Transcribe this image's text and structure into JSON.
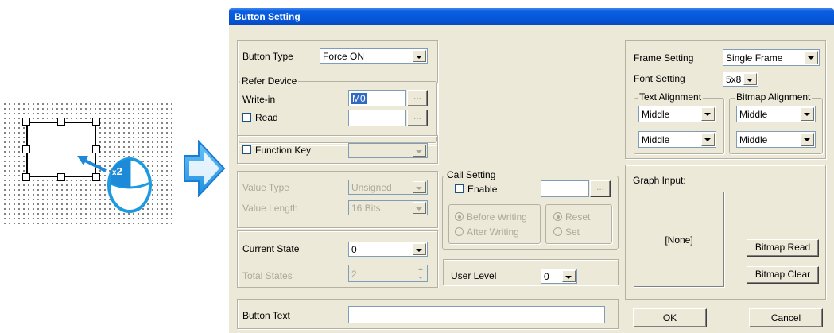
{
  "illustration": {
    "mouse_badge": "x2",
    "mouse_number": "2"
  },
  "dialog": {
    "title": "Button Setting",
    "button_type": {
      "label": "Button Type",
      "value": "Force ON"
    },
    "refer_device": {
      "legend": "Refer Device",
      "write_in_label": "Write-in",
      "write_in_value": "M0",
      "read_label": "Read",
      "browse_label": "..."
    },
    "function_key": {
      "label": "Function Key"
    },
    "value_type": {
      "label": "Value Type",
      "value": "Unsigned"
    },
    "value_length": {
      "label": "Value Length",
      "value": "16 Bits"
    },
    "current_state": {
      "label": "Current State",
      "value": "0"
    },
    "total_states": {
      "label": "Total States",
      "value": "2"
    },
    "button_text": {
      "label": "Button Text",
      "value": ""
    },
    "call_setting": {
      "legend": "Call Setting",
      "enable_label": "Enable",
      "browse_label": "...",
      "before_writing": "Before Writing",
      "after_writing": "After Writing",
      "reset": "Reset",
      "set": "Set"
    },
    "user_level": {
      "label": "User Level",
      "value": "0"
    },
    "frame_setting": {
      "label": "Frame Setting",
      "value": "Single Frame"
    },
    "font_setting": {
      "label": "Font Setting",
      "value": "5x8"
    },
    "text_alignment": {
      "legend": "Text Alignment",
      "horizontal": "Middle",
      "vertical": "Middle"
    },
    "bitmap_alignment": {
      "legend": "Bitmap Alignment",
      "horizontal": "Middle",
      "vertical": "Middle"
    },
    "graph_input": {
      "label": "Graph Input:",
      "preview": "[None]",
      "bitmap_read": "Bitmap Read",
      "bitmap_clear": "Bitmap Clear"
    },
    "ok_label": "OK",
    "cancel_label": "Cancel"
  }
}
